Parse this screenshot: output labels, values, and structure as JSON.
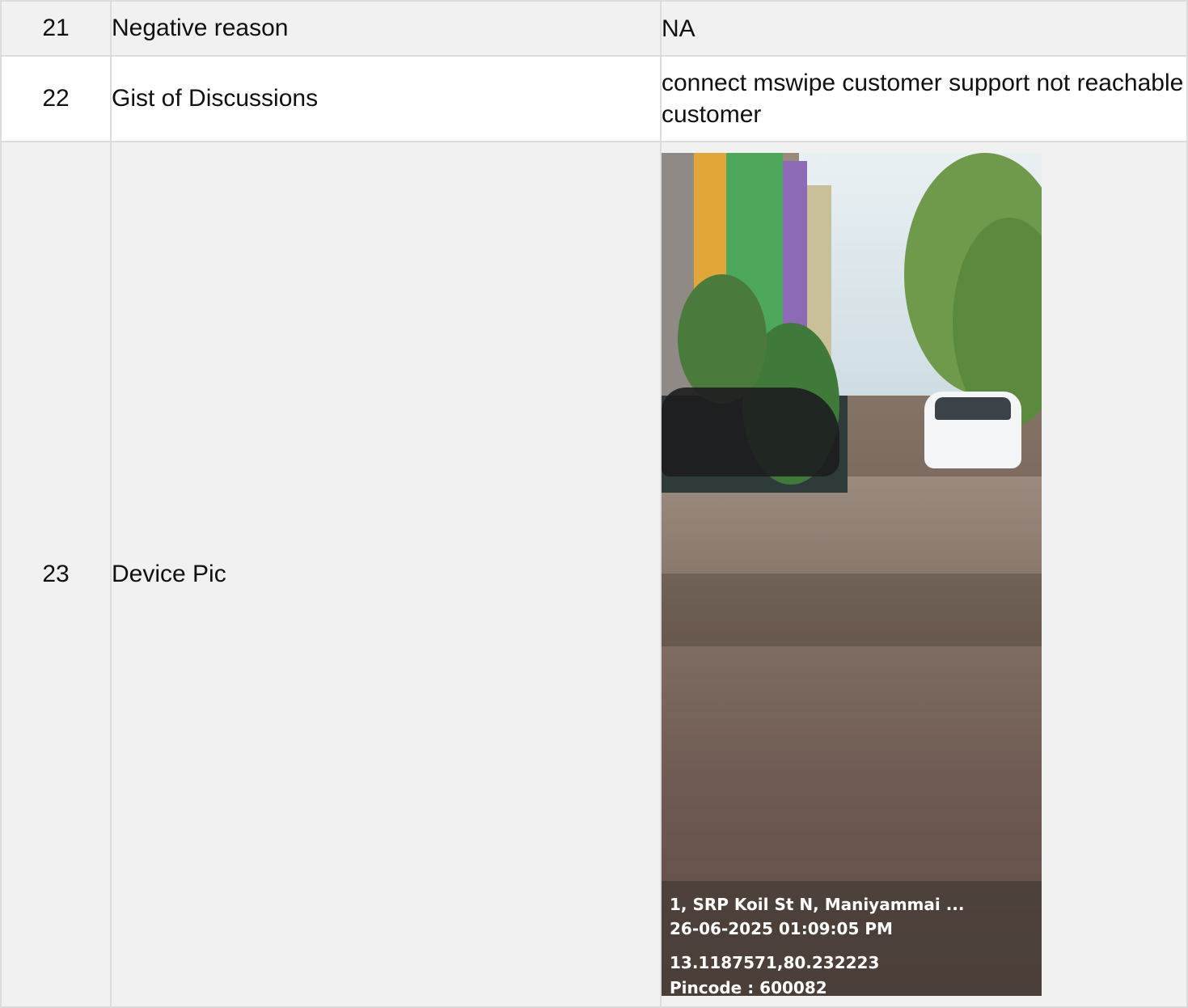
{
  "rows": [
    {
      "no": "21",
      "label": "Negative reason",
      "value": "NA"
    },
    {
      "no": "22",
      "label": "Gist of Discussions",
      "value": "connect mswipe customer support not reachable customer"
    },
    {
      "no": "23",
      "label": "Device Pic"
    }
  ],
  "device_pic": {
    "overlay": {
      "address": "1, SRP Koil St N, Maniyammai ...",
      "datetime": "26-06-2025 01:09:05 PM",
      "coordinates": "13.1187571,80.232223",
      "pincode": "Pincode : 600082"
    }
  }
}
